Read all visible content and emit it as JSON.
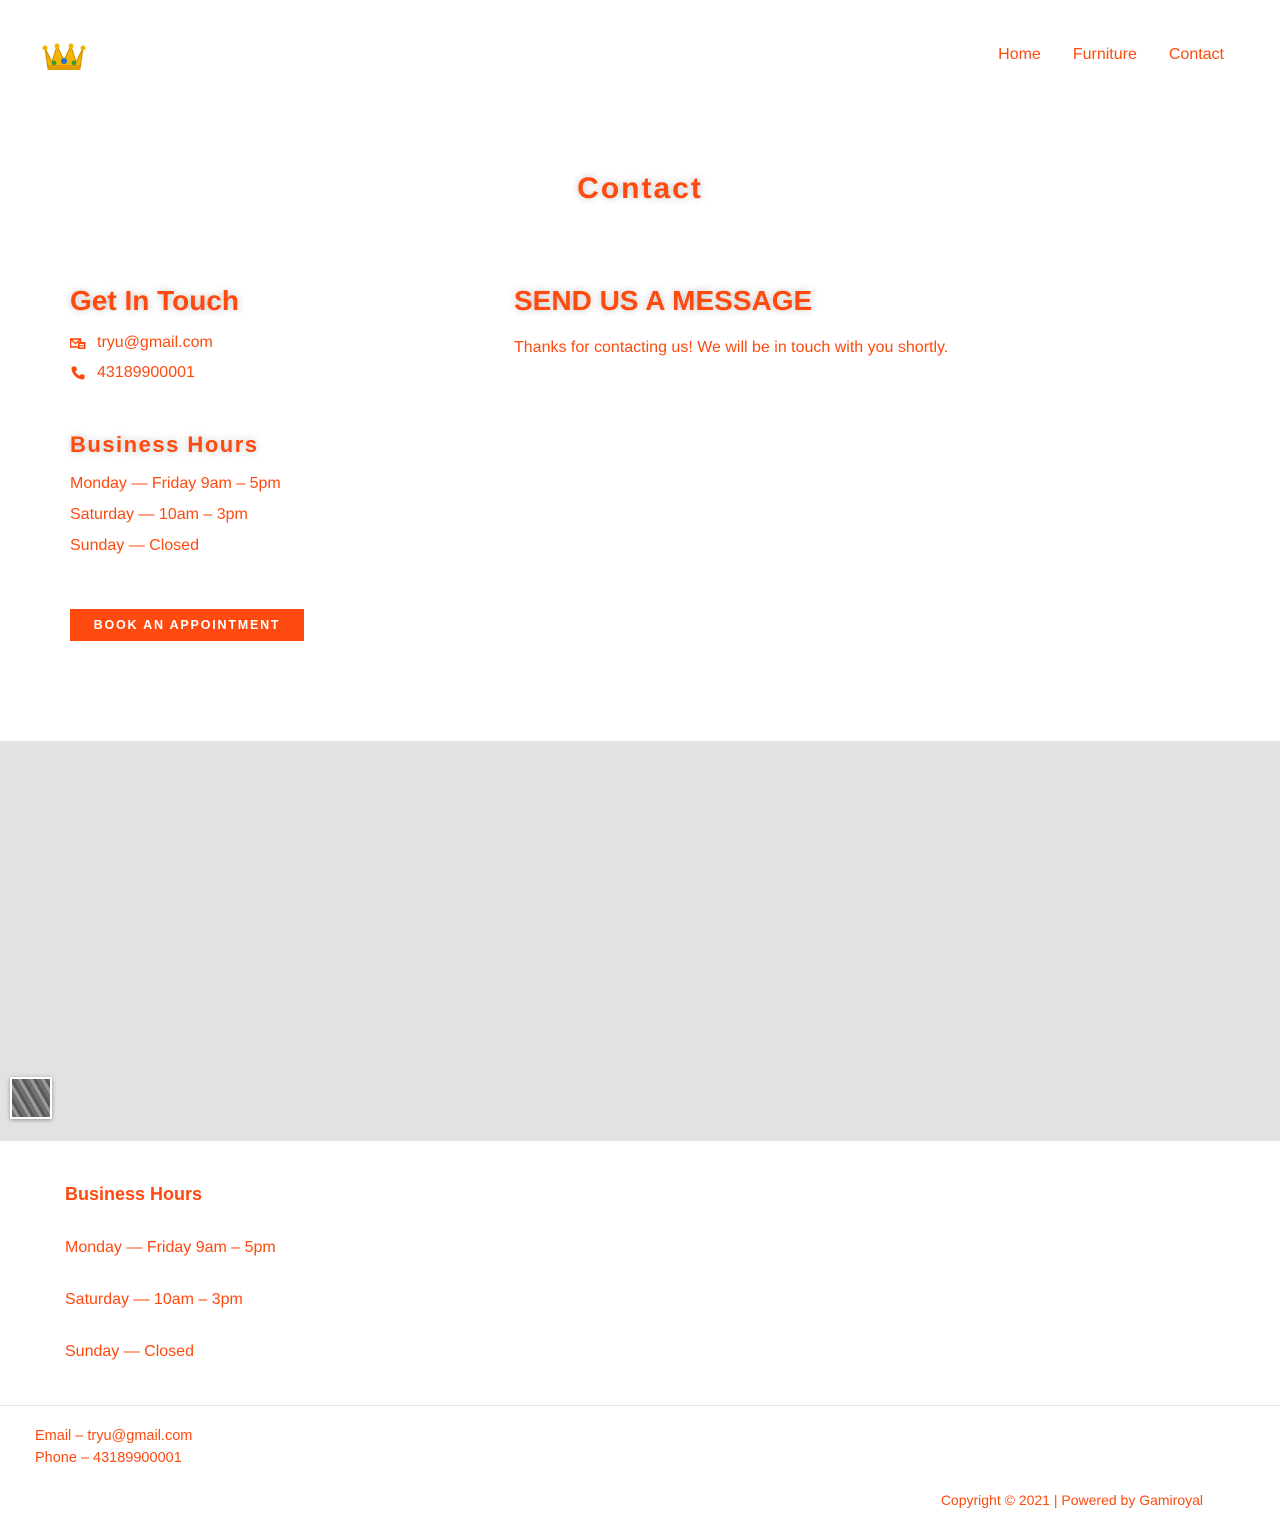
{
  "colors": {
    "accent": "#ff4a0f",
    "map_bg": "#e2e2e2",
    "button_text": "#ffffff"
  },
  "header": {
    "logo_icon": "crown-icon",
    "nav": [
      {
        "label": "Home"
      },
      {
        "label": "Furniture"
      },
      {
        "label": "Contact"
      }
    ]
  },
  "page_title": "Contact",
  "get_in_touch": {
    "title": "Get In Touch",
    "email": "tryu@gmail.com",
    "email_icon": "mail-icon",
    "phone": "43189900001",
    "phone_icon": "phone-icon"
  },
  "business_hours": {
    "title": "Business Hours",
    "lines": [
      "Monday — Friday 9am – 5pm",
      "Saturday — 10am – 3pm",
      "Sunday — Closed"
    ],
    "button_label": "BOOK AN APPOINTMENT"
  },
  "send_message": {
    "title": "SEND US A MESSAGE",
    "confirmation": "Thanks for contacting us! We will be in touch with you shortly."
  },
  "map": {
    "thumb_icon": "map-layer-thumbnail-icon"
  },
  "footer": {
    "hours_title": "Business Hours",
    "hours_lines": [
      "Monday — Friday 9am – 5pm",
      "Saturday — 10am – 3pm",
      "Sunday — Closed"
    ],
    "email_line": "Email – tryu@gmail.com",
    "phone_line": "Phone – 43189900001",
    "copyright": "Copyright © 2021 | Powered by Gamiroyal"
  }
}
